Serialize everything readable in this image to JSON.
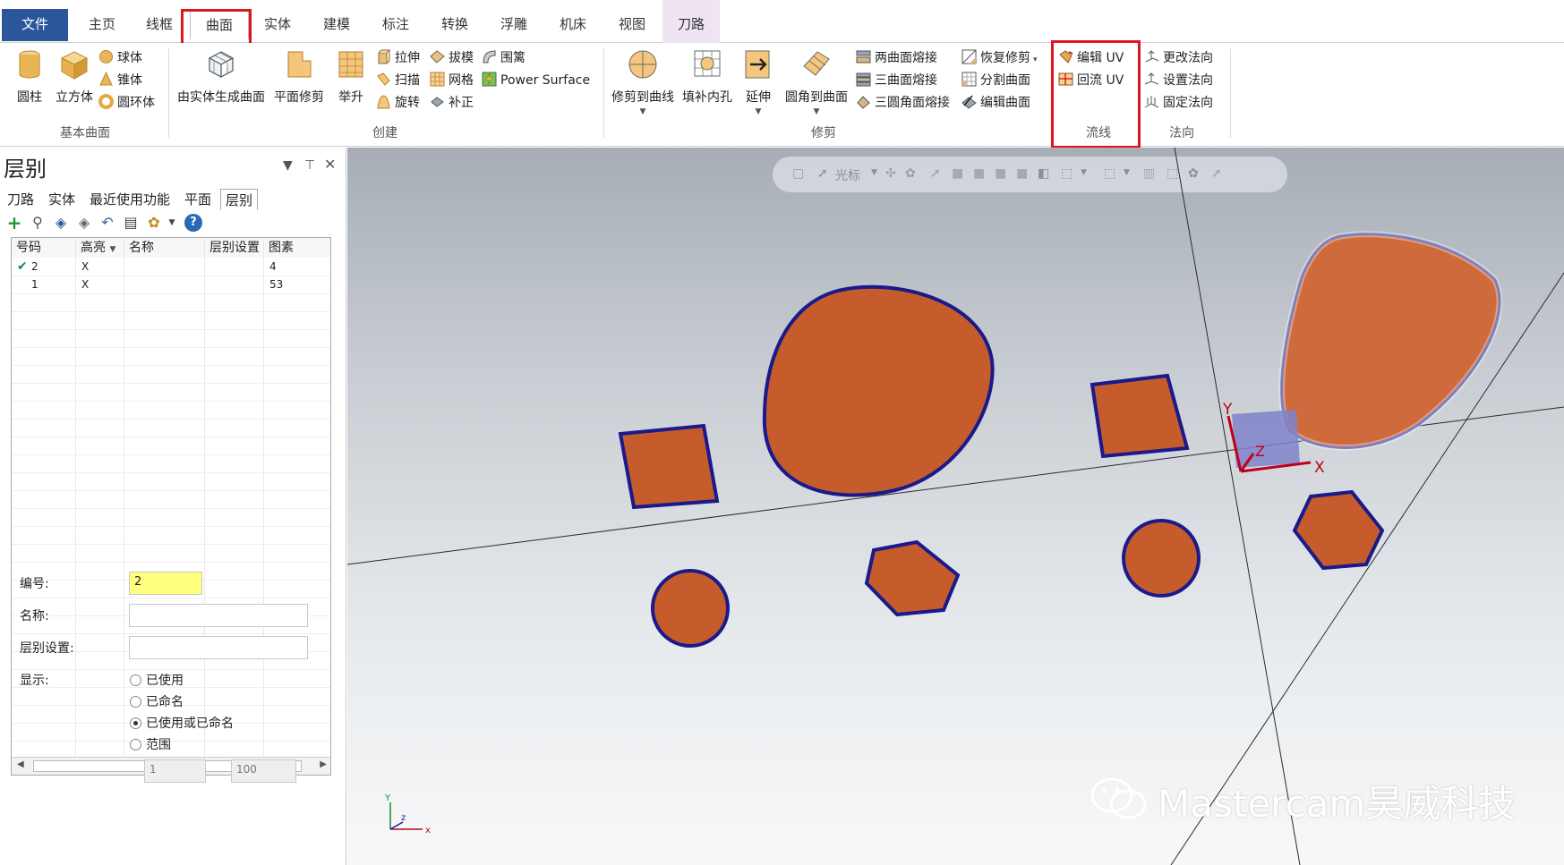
{
  "menu_tabs": [
    "文件",
    "主页",
    "线框",
    "曲面",
    "实体",
    "建模",
    "标注",
    "转换",
    "浮雕",
    "机床",
    "视图",
    "刀路"
  ],
  "ribbon": {
    "basic": {
      "label": "基本曲面",
      "cylinder": "圆柱",
      "cube": "立方体",
      "sphere": "球体",
      "cone": "锥体",
      "torus": "圆环体"
    },
    "create": {
      "label": "创建",
      "from_solid": "由实体生成曲面",
      "flat_trim": "平面修剪",
      "loft": "举升",
      "extrude": "拉伸",
      "sweep": "扫描",
      "revolve": "旋转",
      "draft": "拔模",
      "net": "网格",
      "patch": "补正",
      "fence": "围篱",
      "power_surface": "Power Surface"
    },
    "trim": {
      "label": "修剪",
      "trim_to_curve": "修剪到曲线",
      "fill_holes": "填补内孔",
      "extend": "延伸",
      "fillet_to": "圆角到曲面",
      "two_blend": "两曲面熔接",
      "three_blend": "三曲面熔接",
      "three_fillet_blend": "三圆角面熔接",
      "untrim": "恢复修剪",
      "split": "分割曲面",
      "edit_surface": "编辑曲面"
    },
    "flowline": {
      "label": "流线",
      "edit_uv": "编辑 UV",
      "flow_uv": "回流 UV"
    },
    "normal": {
      "label": "法向",
      "change": "更改法向",
      "set": "设置法向",
      "fix": "固定法向"
    }
  },
  "panel": {
    "title": "层别",
    "tabs": [
      "刀路",
      "实体",
      "最近使用功能",
      "平面",
      "层别"
    ],
    "columns": [
      "号码",
      "高亮",
      "名称",
      "层别设置",
      "图素"
    ],
    "rows": [
      {
        "num": "2",
        "highlight": "X",
        "name": "",
        "setting": "",
        "count": "4",
        "current": true
      },
      {
        "num": "1",
        "highlight": "X",
        "name": "",
        "setting": "",
        "count": "53",
        "current": false
      }
    ],
    "form": {
      "number_label": "编号:",
      "number_value": "2",
      "name_label": "名称:",
      "name_value": "",
      "setting_label": "层别设置:",
      "setting_value": "",
      "display_label": "显示:",
      "options": [
        "已使用",
        "已命名",
        "已使用或已命名",
        "范围"
      ],
      "selected_option": 2,
      "range_from": "1",
      "range_to": "100"
    }
  },
  "viewport": {
    "toolbar": {
      "cursor_label": "光标"
    },
    "axis_labels": {
      "x": "X",
      "y": "Y",
      "z": "Z"
    },
    "mini_axis": {
      "x": "x",
      "y": "Y",
      "z": "z"
    },
    "watermark": "Mastercam昊威科技"
  },
  "colors": {
    "shape_fill": "#c65c2c",
    "shape_stroke": "#1a1a8a",
    "file_tab": "#2b579a",
    "toolpath_tab": "#efe4f2",
    "highlight": "#e0141e",
    "axis_red": "#c0001a"
  }
}
